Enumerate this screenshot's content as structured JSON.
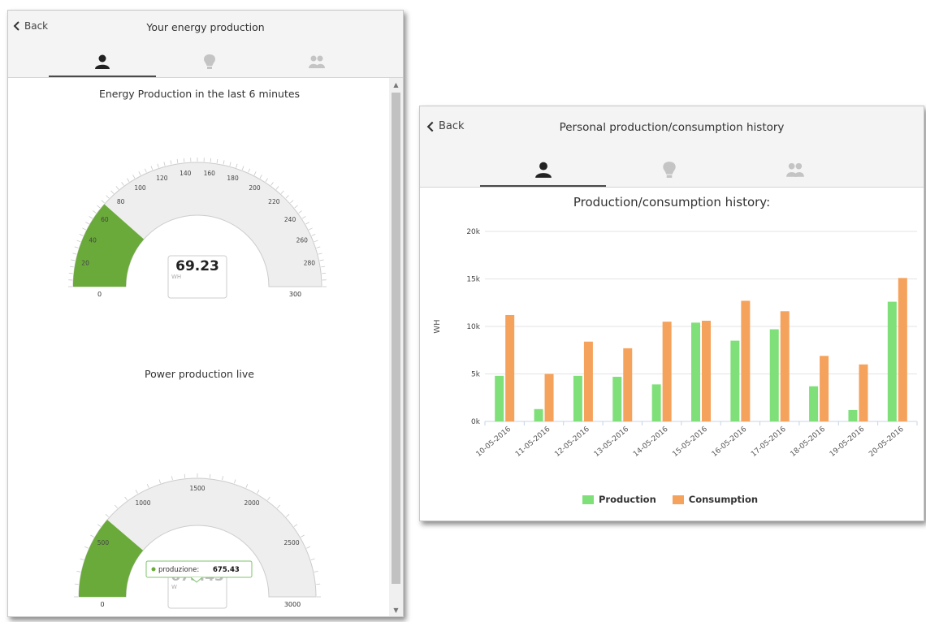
{
  "left_panel": {
    "back_label": "Back",
    "title": "Your energy production",
    "tabs": [
      {
        "icon": "person-icon",
        "active": true
      },
      {
        "icon": "bulb-icon",
        "active": false
      },
      {
        "icon": "group-icon",
        "active": false
      }
    ],
    "gauge_energy": {
      "title": "Energy Production in the last 6 minutes",
      "value": 69.23,
      "value_label": "69.23",
      "unit": "WH",
      "min": 0,
      "max": 300,
      "min_label": "0",
      "max_label": "300",
      "tick_labels": [
        "20",
        "40",
        "60",
        "80",
        "100",
        "120",
        "140",
        "160",
        "180",
        "200",
        "220",
        "240",
        "260",
        "280"
      ]
    },
    "gauge_power": {
      "title": "Power production live",
      "value": 675.43,
      "value_label": "675.43",
      "unit": "W",
      "min": 0,
      "max": 3000,
      "min_label": "0",
      "max_label": "3000",
      "tick_labels": [
        "500",
        "1000",
        "1500",
        "2000",
        "2500"
      ],
      "tooltip": {
        "series": "produzione:",
        "value": "675.43"
      }
    }
  },
  "right_panel": {
    "back_label": "Back",
    "title": "Personal production/consumption history",
    "tabs": [
      {
        "icon": "person-icon",
        "active": true
      },
      {
        "icon": "bulb-icon",
        "active": false
      },
      {
        "icon": "group-icon",
        "active": false
      }
    ]
  },
  "colors": {
    "production": "#7fe07a",
    "consumption": "#f5a25c",
    "gauge_fill": "#6aaa3a",
    "gauge_track": "#eeeeee"
  },
  "chart_data": {
    "type": "bar",
    "title": "Production/consumption history:",
    "ylabel": "WH",
    "xlabel": "",
    "ylim": [
      0,
      20000
    ],
    "yticks": [
      0,
      5000,
      10000,
      15000,
      20000
    ],
    "ytick_labels": [
      "0k",
      "5k",
      "10k",
      "15k",
      "20k"
    ],
    "categories": [
      "10-05-2016",
      "11-05-2016",
      "12-05-2016",
      "13-05-2016",
      "14-05-2016",
      "15-05-2016",
      "16-05-2016",
      "17-05-2016",
      "18-05-2016",
      "19-05-2016",
      "20-05-2016"
    ],
    "series": [
      {
        "name": "Production",
        "values": [
          4800,
          1300,
          4800,
          4700,
          3900,
          10400,
          8500,
          9700,
          3700,
          1200,
          12600
        ]
      },
      {
        "name": "Consumption",
        "values": [
          11200,
          5000,
          8400,
          7700,
          10500,
          10600,
          12700,
          11600,
          6900,
          6000,
          15100
        ]
      }
    ],
    "legend": "bottom",
    "grid": true
  }
}
